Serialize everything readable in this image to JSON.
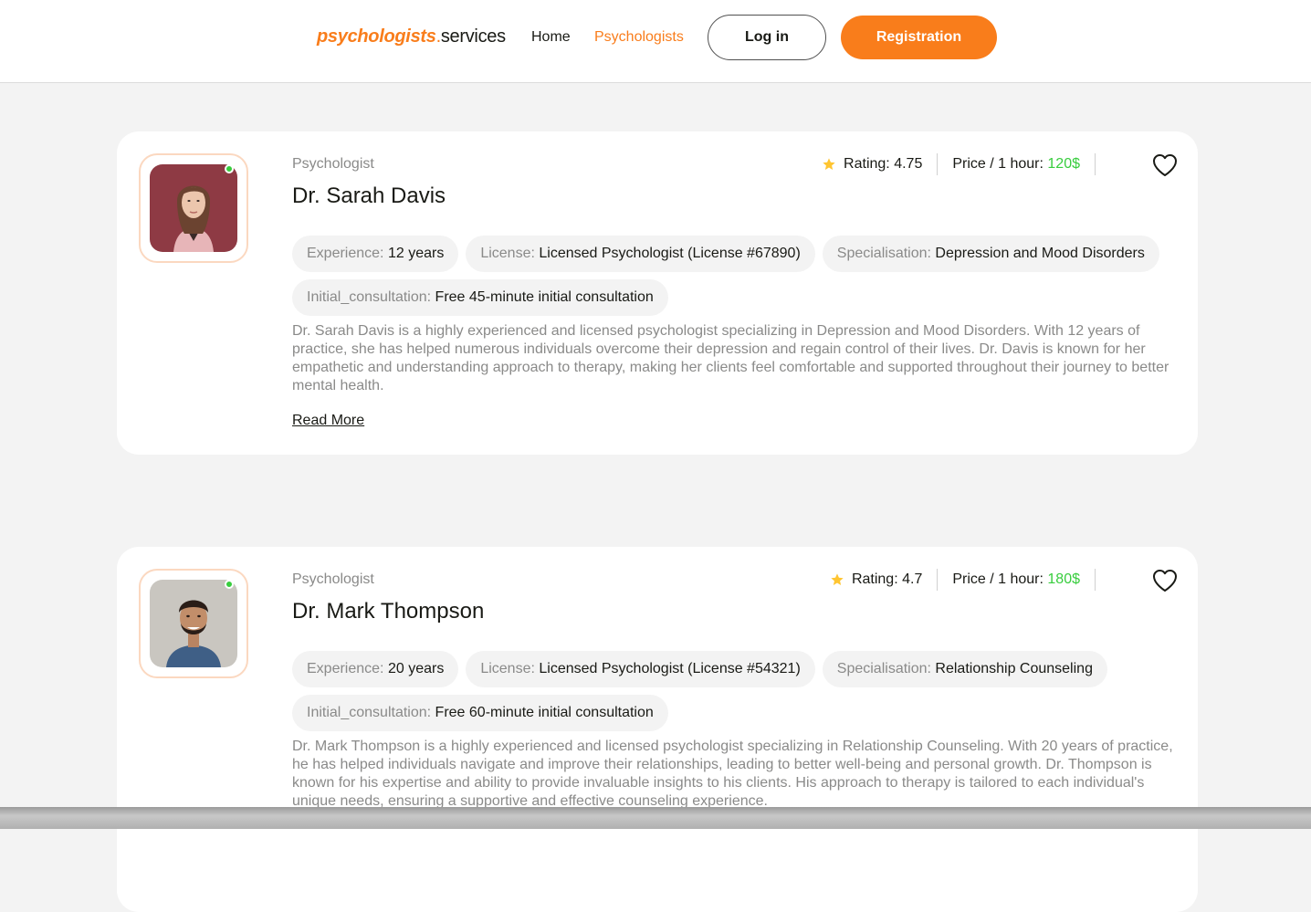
{
  "header": {
    "logo": {
      "part1": "psychologists",
      "part2": ".",
      "part3": "services"
    },
    "nav": {
      "home": "Home",
      "psychologists": "Psychologists"
    },
    "login_label": "Log in",
    "register_label": "Registration"
  },
  "cards": [
    {
      "role": "Psychologist",
      "name": "Dr. Sarah Davis",
      "rating_label": "Rating:",
      "rating": "4.75",
      "price_label": "Price / 1 hour:",
      "price": "120$",
      "tags": [
        {
          "key": "Experience:",
          "value": "12 years"
        },
        {
          "key": "License:",
          "value": "Licensed Psychologist (License #67890)"
        },
        {
          "key": "Specialisation:",
          "value": "Depression and Mood Disorders"
        },
        {
          "key": "Initial_consultation:",
          "value": "Free 45-minute initial consultation"
        }
      ],
      "description": "Dr. Sarah Davis is a highly experienced and licensed psychologist specializing in Depression and Mood Disorders. With 12 years of practice, she has helped numerous individuals overcome their depression and regain control of their lives. Dr. Davis is known for her empathetic and understanding approach to therapy, making her clients feel comfortable and supported throughout their journey to better mental health.",
      "read_more": "Read More"
    },
    {
      "role": "Psychologist",
      "name": "Dr. Mark Thompson",
      "rating_label": "Rating:",
      "rating": "4.7",
      "price_label": "Price / 1 hour:",
      "price": "180$",
      "tags": [
        {
          "key": "Experience:",
          "value": "20 years"
        },
        {
          "key": "License:",
          "value": "Licensed Psychologist (License #54321)"
        },
        {
          "key": "Specialisation:",
          "value": "Relationship Counseling"
        },
        {
          "key": "Initial_consultation:",
          "value": "Free 60-minute initial consultation"
        }
      ],
      "description": "Dr. Mark Thompson is a highly experienced and licensed psychologist specializing in Relationship Counseling. With 20 years of practice, he has helped individuals navigate and improve their relationships, leading to better well-being and personal growth. Dr. Thompson is known for his expertise and ability to provide invaluable insights to his clients. His approach to therapy is tailored to each individual's unique needs, ensuring a supportive and effective counseling experience."
    }
  ],
  "icons": {
    "star": "star-icon",
    "heart": "heart-icon",
    "online": "online-status-icon"
  },
  "colors": {
    "accent": "#f97d1b",
    "price": "#38cd3e",
    "star": "#ffc531",
    "muted_text": "#8a8a89"
  }
}
